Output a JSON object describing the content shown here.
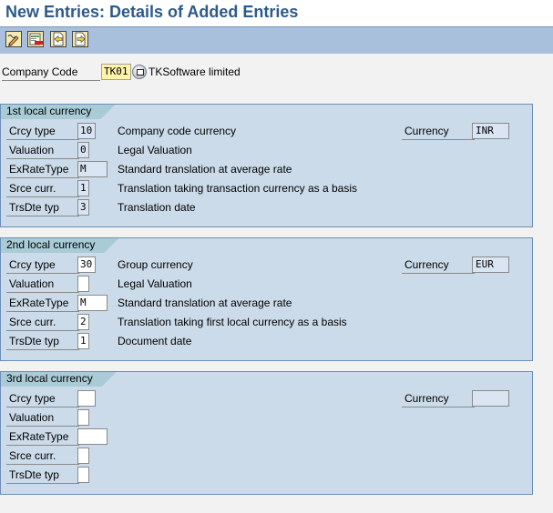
{
  "title": "New Entries: Details of Added Entries",
  "toolbar": {
    "buttons": [
      {
        "icon": "display-change-icon",
        "tooltip": "Display/Change"
      },
      {
        "icon": "delete-entry-icon",
        "tooltip": "Delete"
      },
      {
        "icon": "previous-entry-icon",
        "tooltip": "Previous entry"
      },
      {
        "icon": "next-entry-icon",
        "tooltip": "Next entry"
      }
    ]
  },
  "header": {
    "company_code_label": "Company Code",
    "company_code_value": "TK01",
    "company_name": "TKSoftware limited"
  },
  "groups": [
    {
      "title": "1st local currency",
      "currency_label": "Currency",
      "currency_value": "INR",
      "fields": [
        {
          "label": "Crcy type",
          "value": "10",
          "desc": "Company code currency",
          "readonly": true
        },
        {
          "label": "Valuation",
          "value": "0",
          "desc": "Legal Valuation",
          "readonly": true
        },
        {
          "label": "ExRateType",
          "value": "M",
          "desc": "Standard translation at average rate",
          "readonly": true
        },
        {
          "label": "Srce curr.",
          "value": "1",
          "desc": "Translation taking transaction currency as a basis",
          "readonly": true
        },
        {
          "label": "TrsDte typ",
          "value": "3",
          "desc": "Translation date",
          "readonly": true
        }
      ]
    },
    {
      "title": "2nd local currency",
      "currency_label": "Currency",
      "currency_value": "EUR",
      "fields": [
        {
          "label": "Crcy type",
          "value": "30",
          "desc": "Group currency",
          "readonly": false
        },
        {
          "label": "Valuation",
          "value": "",
          "desc": "Legal Valuation",
          "readonly": false
        },
        {
          "label": "ExRateType",
          "value": "M",
          "desc": "Standard translation at average rate",
          "readonly": false
        },
        {
          "label": "Srce curr.",
          "value": "2",
          "desc": "Translation taking first local currency as a basis",
          "readonly": false
        },
        {
          "label": "TrsDte typ",
          "value": "1",
          "desc": "Document date",
          "readonly": false
        }
      ]
    },
    {
      "title": "3rd local currency",
      "currency_label": "Currency",
      "currency_value": "",
      "fields": [
        {
          "label": "Crcy type",
          "value": "",
          "desc": "",
          "readonly": false
        },
        {
          "label": "Valuation",
          "value": "",
          "desc": "",
          "readonly": false
        },
        {
          "label": "ExRateType",
          "value": "",
          "desc": "",
          "readonly": false
        },
        {
          "label": "Srce curr.",
          "value": "",
          "desc": "",
          "readonly": false
        },
        {
          "label": "TrsDte typ",
          "value": "",
          "desc": "",
          "readonly": false
        }
      ]
    }
  ]
}
